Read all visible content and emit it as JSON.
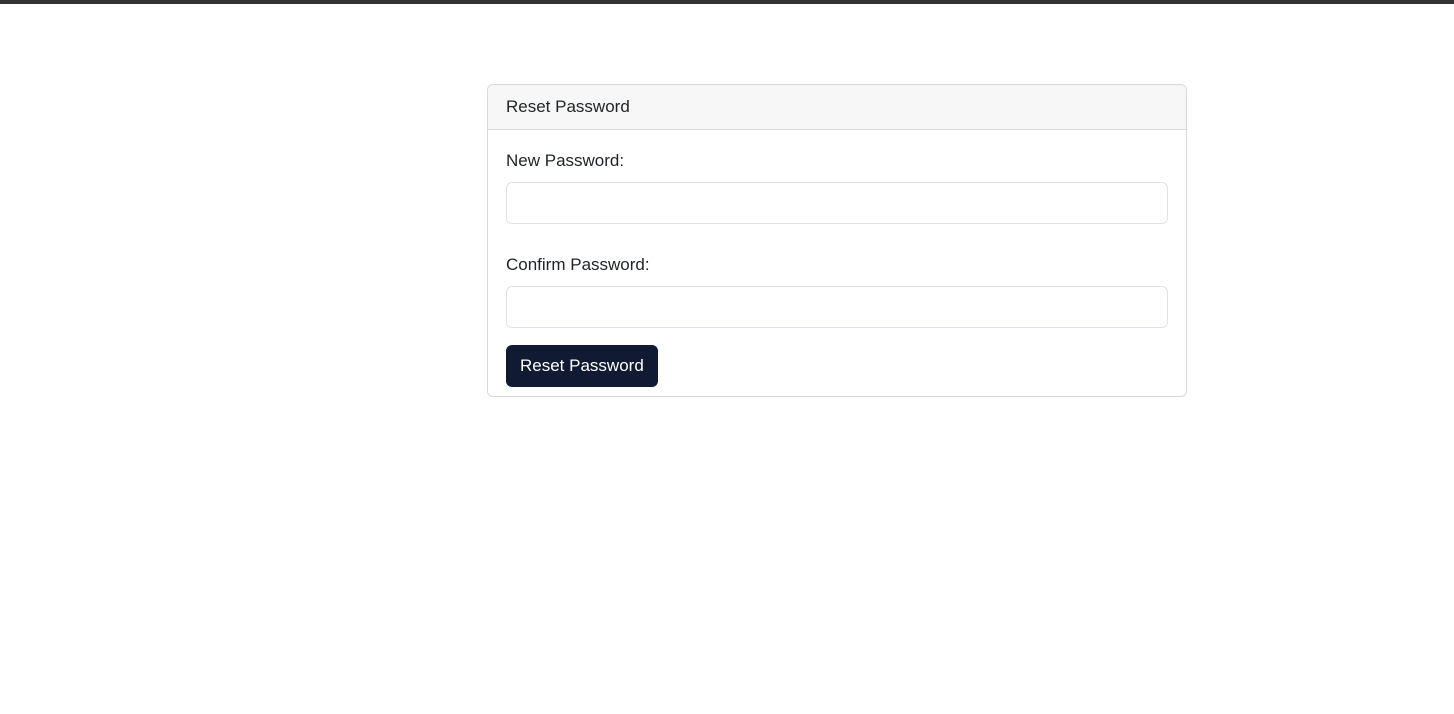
{
  "colors": {
    "top_bar": "#333333",
    "card_header_bg": "#f7f7f7",
    "card_border": "#d9d9d9",
    "button_bg": "#111a33",
    "button_text": "#ffffff"
  },
  "card": {
    "title": "Reset Password"
  },
  "form": {
    "new_password": {
      "label": "New Password:",
      "value": "",
      "placeholder": ""
    },
    "confirm_password": {
      "label": "Confirm Password:",
      "value": "",
      "placeholder": ""
    },
    "submit_label": "Reset Password"
  }
}
